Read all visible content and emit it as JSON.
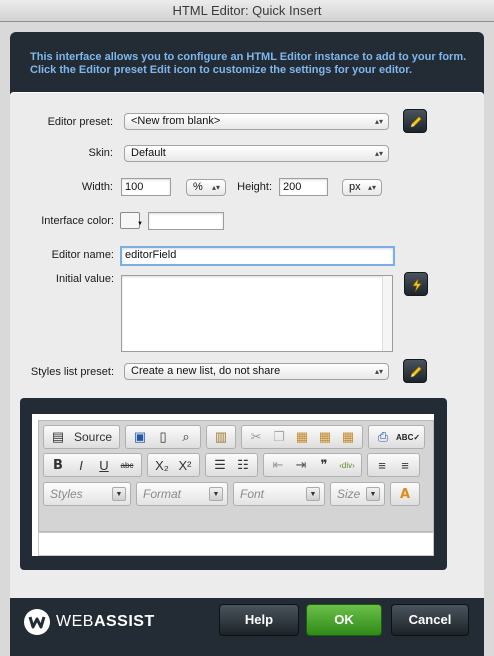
{
  "window": {
    "title": "HTML Editor: Quick Insert"
  },
  "intro": "This interface allows you to configure an HTML Editor instance to add to your form. Click the Editor preset Edit icon to customize the settings for your editor.",
  "form": {
    "editor_preset_label": "Editor preset:",
    "editor_preset_value": "<New from blank>",
    "skin_label": "Skin:",
    "skin_value": "Default",
    "width_label": "Width:",
    "width_value": "100",
    "width_unit": "%",
    "height_label": "Height:",
    "height_value": "200",
    "height_unit": "px",
    "interface_color_label": "Interface color:",
    "interface_color_value": "",
    "editor_name_label": "Editor name:",
    "editor_name_value": "editorField",
    "initial_value_label": "Initial value:",
    "initial_value": "",
    "styles_list_label": "Styles list preset:",
    "styles_list_value": "Create a new list, do not share"
  },
  "preview": {
    "source_label": "Source",
    "combos": [
      "Styles",
      "Format",
      "Font",
      "Size"
    ],
    "row2_buttons": [
      "B",
      "I",
      "U",
      "abc",
      "X₂",
      "X²"
    ]
  },
  "footer": {
    "logo_web": "WEB",
    "logo_assist": "ASSIST",
    "help": "Help",
    "ok": "OK",
    "cancel": "Cancel"
  },
  "colors": {
    "intro_text": "#7fb7ec",
    "ok_button": "#3f9a22",
    "frame": "#232c35"
  },
  "icons": [
    "pencil-icon",
    "lightning-icon",
    "pencil-icon",
    "webassist-logo-icon"
  ]
}
